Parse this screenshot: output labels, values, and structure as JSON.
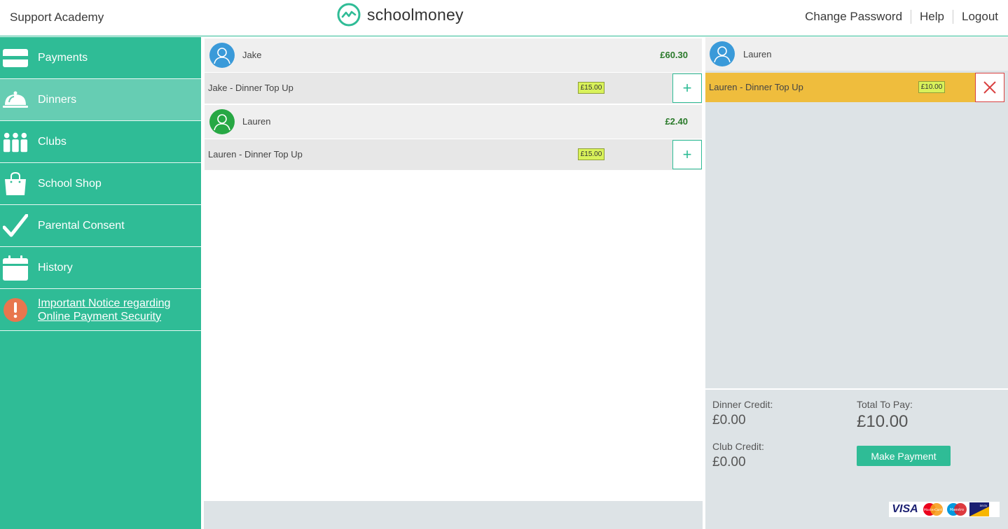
{
  "header": {
    "school_name": "Support Academy",
    "logo_text": "schoolmoney",
    "nav": [
      "Change Password",
      "Help",
      "Logout"
    ]
  },
  "sidebar": {
    "items": [
      {
        "label": "Payments",
        "icon": "card-icon"
      },
      {
        "label": "Dinners",
        "icon": "cloche-icon",
        "active": true
      },
      {
        "label": "Clubs",
        "icon": "people-icon"
      },
      {
        "label": "School Shop",
        "icon": "shopping-bag-icon"
      },
      {
        "label": "Parental Consent",
        "icon": "checkmark-icon"
      },
      {
        "label": "History",
        "icon": "calendar-icon"
      },
      {
        "label": "Important Notice regarding Online Payment Security",
        "icon": "exclamation-icon"
      }
    ]
  },
  "children": [
    {
      "name": "Jake",
      "balance": "£60.30",
      "avatar_color": "#3a9ad9",
      "item": {
        "label": "Jake - Dinner Top Up",
        "price": "£15.00"
      }
    },
    {
      "name": "Lauren",
      "balance": "£2.40",
      "avatar_color": "#27a844",
      "item": {
        "label": "Lauren - Dinner Top Up",
        "price": "£15.00"
      }
    }
  ],
  "basket": {
    "child_name": "Lauren",
    "item": {
      "label": "Lauren - Dinner Top Up",
      "price": "£10.00"
    },
    "dinner_credit_label": "Dinner Credit:",
    "dinner_credit_value": "£0.00",
    "club_credit_label": "Club Credit:",
    "club_credit_value": "£0.00",
    "total_label": "Total To Pay:",
    "total_value": "£10.00",
    "pay_button": "Make Payment",
    "card_logos": {
      "visa": "VISA",
      "mastercard": "MasterCard",
      "maestro": "Maestro",
      "delta": "DELTA"
    }
  },
  "colors": {
    "brand_green": "#2fbc96",
    "basket_highlight": "#efbd3d",
    "price_tag": "#d9f25a",
    "remove_red": "#d94040"
  }
}
